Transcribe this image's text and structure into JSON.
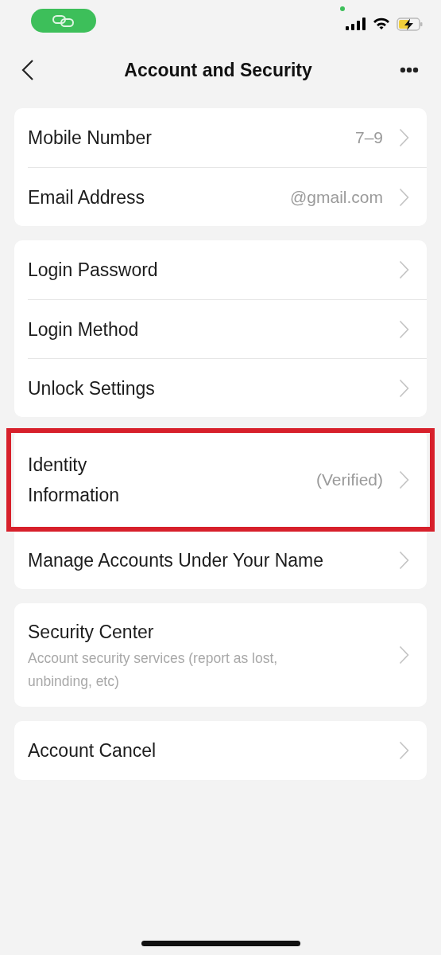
{
  "nav": {
    "title": "Account and Security"
  },
  "groups": [
    {
      "items": [
        {
          "label": "Mobile Number",
          "value": "7–9",
          "highlighted": false
        },
        {
          "label": "Email Address",
          "value": "@gmail.com",
          "highlighted": false
        }
      ]
    },
    {
      "items": [
        {
          "label": "Login Password",
          "highlighted": false
        },
        {
          "label": "Login Method",
          "highlighted": false
        },
        {
          "label": "Unlock Settings",
          "highlighted": false
        }
      ]
    },
    {
      "items": [
        {
          "label": "Identity Information",
          "value": "(Verified)",
          "highlighted": true
        },
        {
          "label": "Manage Accounts Under Your Name",
          "highlighted": false
        }
      ]
    },
    {
      "items": [
        {
          "label": "Security Center",
          "subtitle": "Account security services (report as lost, unbinding, etc)",
          "highlighted": false
        }
      ]
    },
    {
      "items": [
        {
          "label": "Account Cancel",
          "highlighted": false
        }
      ]
    }
  ]
}
